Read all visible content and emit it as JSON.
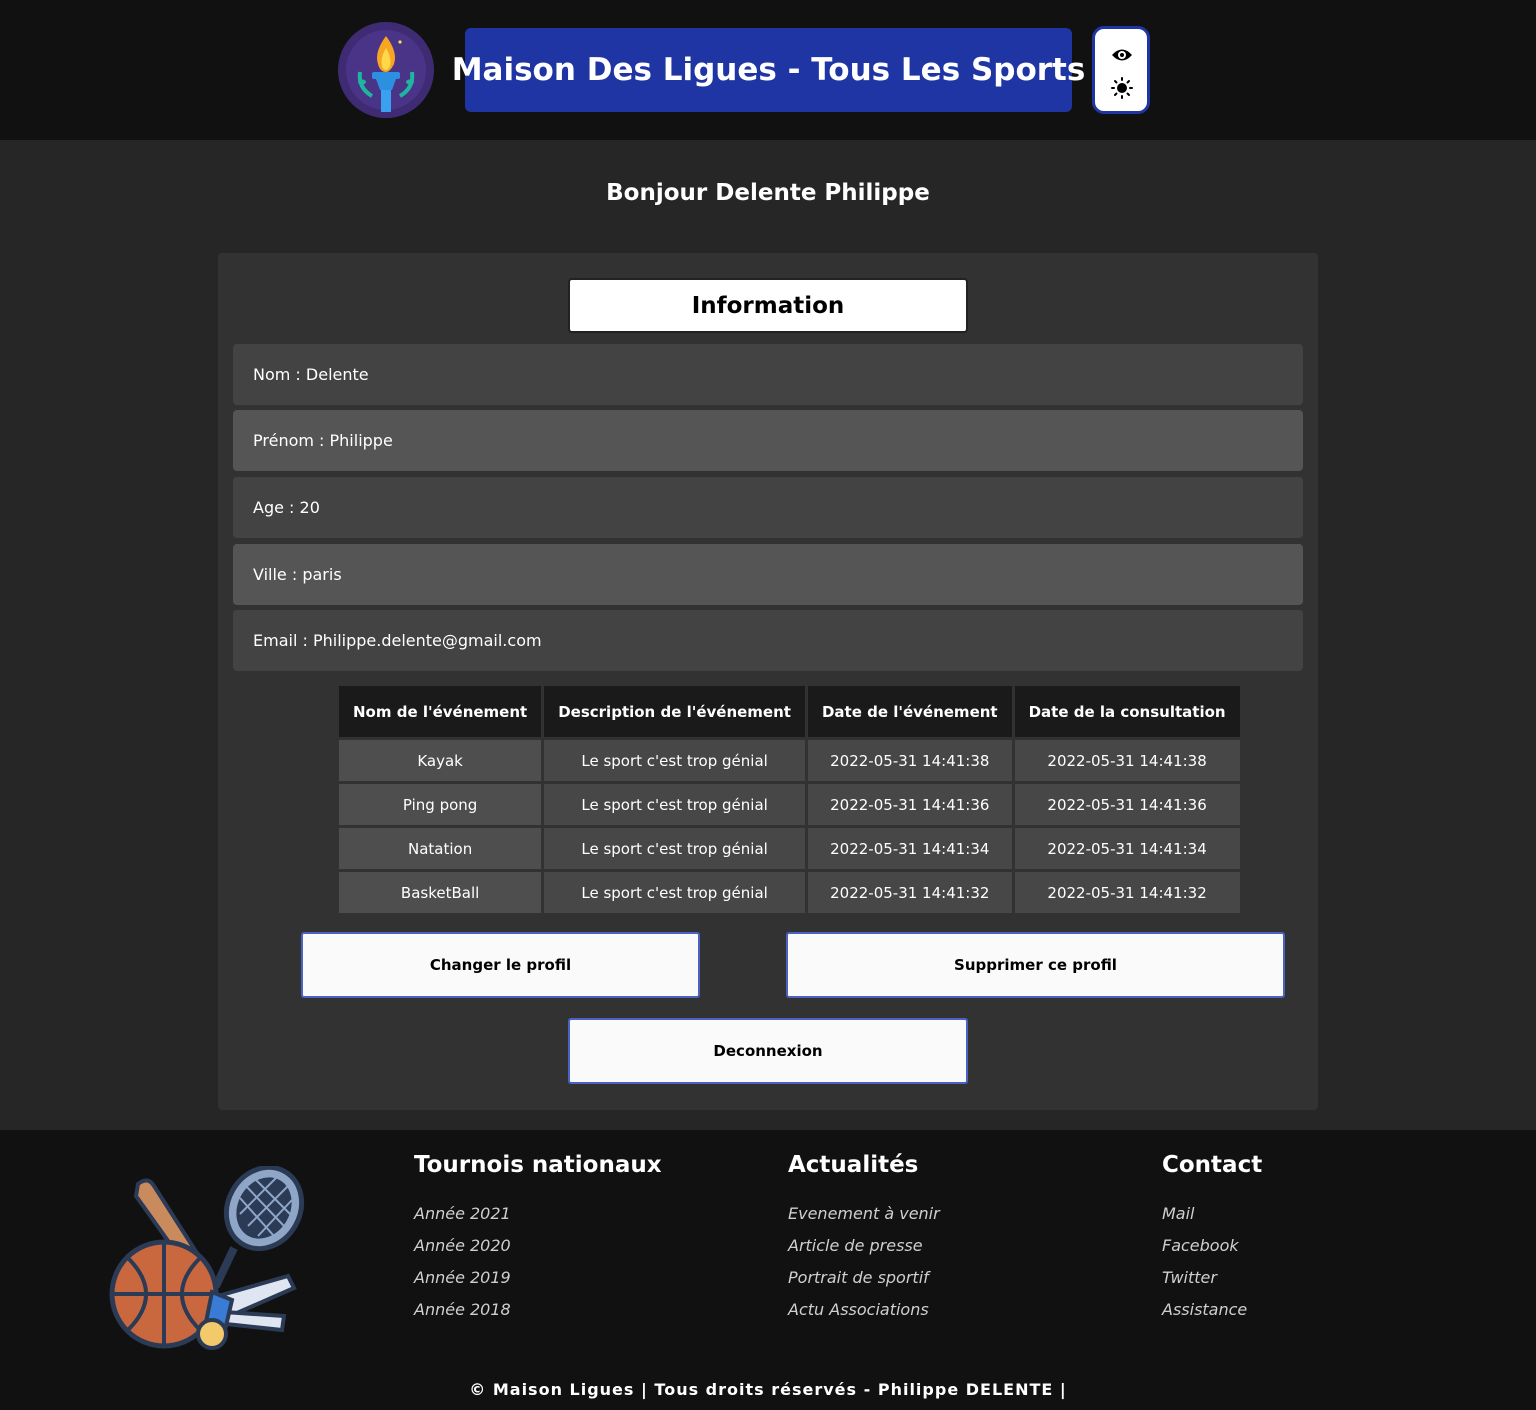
{
  "header": {
    "title": "Maison Des Ligues - Tous Les Sports",
    "logo_icon": "torch-icon",
    "toggle_icons": [
      "eye-icon",
      "sun-icon"
    ],
    "brand_color": "#1f35a3"
  },
  "greeting": "Bonjour Delente Philippe",
  "info": {
    "title": "Information",
    "fields": [
      {
        "label": "Nom : Delente"
      },
      {
        "label": "Prénom : Philippe"
      },
      {
        "label": "Age : 20"
      },
      {
        "label": "Ville : paris"
      },
      {
        "label": "Email : Philippe.delente@gmail.com"
      }
    ]
  },
  "table": {
    "headers": [
      "Nom de l'événement",
      "Description de l'événement",
      "Date de l'événement",
      "Date de la consultation"
    ],
    "rows": [
      [
        "Kayak",
        "Le sport c'est trop génial",
        "2022-05-31 14:41:38",
        "2022-05-31 14:41:38"
      ],
      [
        "Ping pong",
        "Le sport c'est trop génial",
        "2022-05-31 14:41:36",
        "2022-05-31 14:41:36"
      ],
      [
        "Natation",
        "Le sport c'est trop génial",
        "2022-05-31 14:41:34",
        "2022-05-31 14:41:34"
      ],
      [
        "BasketBall",
        "Le sport c'est trop génial",
        "2022-05-31 14:41:32",
        "2022-05-31 14:41:32"
      ]
    ]
  },
  "buttons": {
    "change": "Changer le profil",
    "delete": "Supprimer ce profil",
    "logout": "Deconnexion"
  },
  "footer": {
    "art_icon": "sports-equipment-icon",
    "columns": [
      {
        "title": "Tournois nationaux",
        "links": [
          "Année 2021",
          "Année 2020",
          "Année 2019",
          "Année 2018"
        ]
      },
      {
        "title": "Actualités",
        "links": [
          "Evenement à venir",
          "Article de presse",
          "Portrait de sportif",
          "Actu Associations"
        ]
      },
      {
        "title": "Contact",
        "links": [
          "Mail",
          "Facebook",
          "Twitter",
          "Assistance"
        ]
      }
    ],
    "copyright": "© Maison Ligues | Tous droits réservés - Philippe DELENTE |"
  }
}
